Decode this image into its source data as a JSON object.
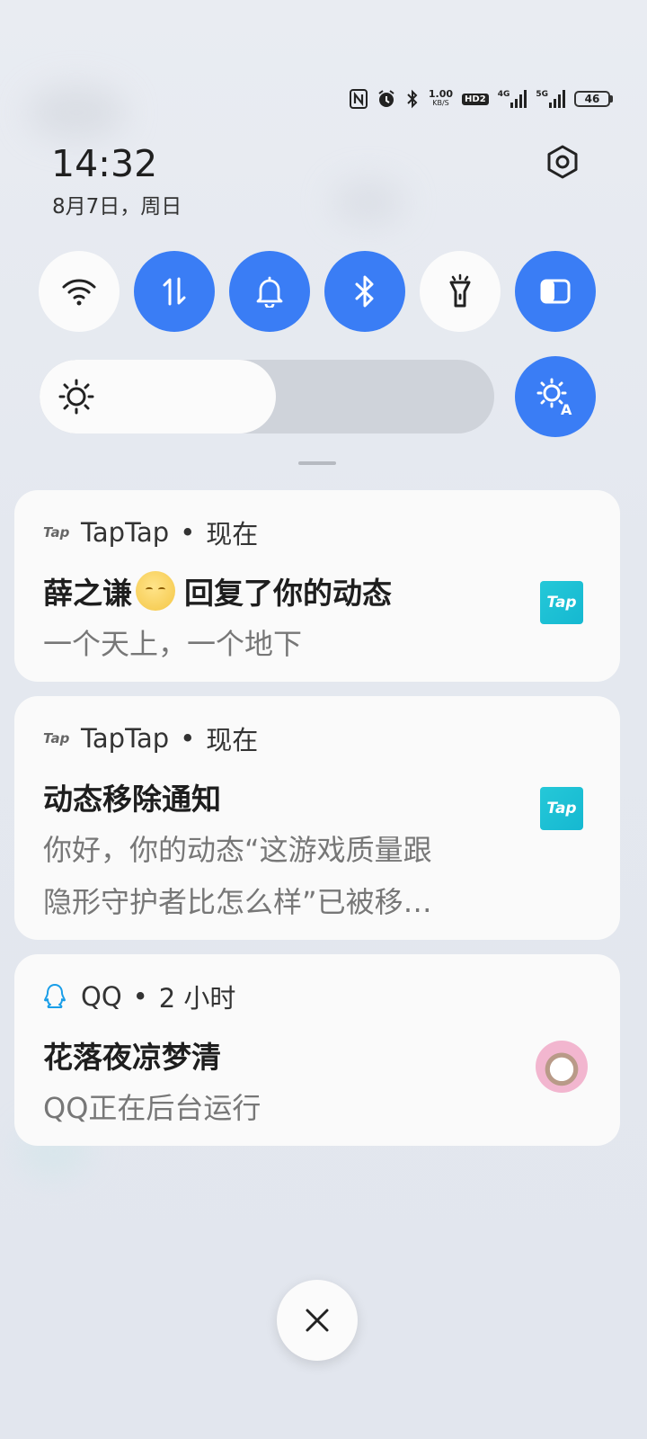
{
  "status_bar": {
    "nfc_icon": "nfc-icon",
    "alarm_icon": "alarm-icon",
    "bluetooth_icon": "bluetooth-icon",
    "net_speed_value": "1.00",
    "net_speed_unit": "KB/S",
    "hd_label": "HD2",
    "signal_1_label": "4G",
    "signal_2_label": "5G",
    "battery_level": "46"
  },
  "header": {
    "time": "14:32",
    "date": "8月7日，周日"
  },
  "quick_toggles": [
    {
      "name": "wifi",
      "icon": "wifi-icon",
      "active": false
    },
    {
      "name": "mobile-data",
      "icon": "mobile-data-icon",
      "active": true
    },
    {
      "name": "ring",
      "icon": "bell-icon",
      "active": true
    },
    {
      "name": "bluetooth",
      "icon": "bluetooth-icon",
      "active": true
    },
    {
      "name": "flashlight",
      "icon": "flashlight-icon",
      "active": false
    },
    {
      "name": "dark-mode",
      "icon": "dark-mode-icon",
      "active": true
    }
  ],
  "brightness": {
    "level": 0.52,
    "icon": "sun-icon",
    "auto_icon": "auto-brightness-icon"
  },
  "notifications": [
    {
      "app": "TapTap",
      "app_mini_label": "Tap",
      "time": "现在",
      "title": "薛之谦",
      "title_suffix": "回复了你的动态",
      "body": "一个天上，一个地下",
      "icon_label": "Tap"
    },
    {
      "app": "TapTap",
      "app_mini_label": "Tap",
      "time": "现在",
      "title": "动态移除通知",
      "body_line1": "你好，你的动态“这游戏质量跟",
      "body_line2": "隐形守护者比怎么样”已被移…",
      "icon_label": "Tap"
    },
    {
      "app": "QQ",
      "time": "2 小时",
      "title": "花落夜凉梦清",
      "body": "QQ正在后台运行"
    }
  ],
  "separator": "•",
  "colors": {
    "accent": "#3a7df5",
    "card_bg": "#fafafa",
    "taptap": "#15b8d1"
  }
}
